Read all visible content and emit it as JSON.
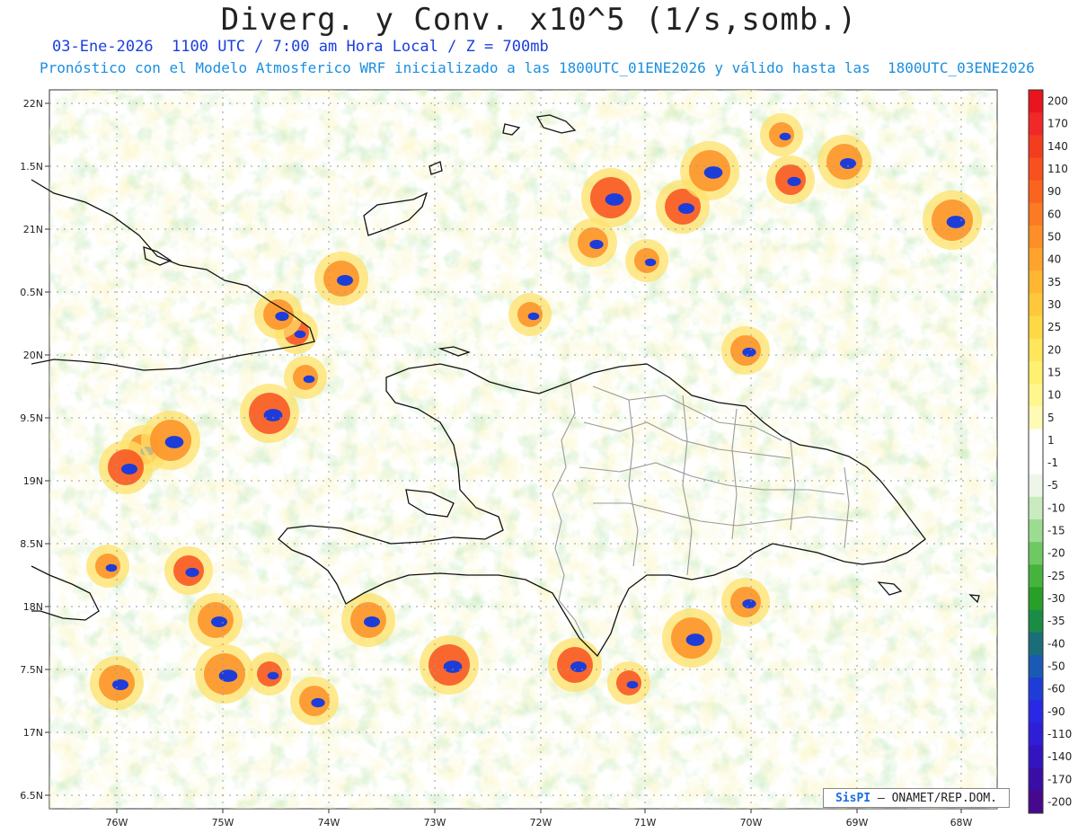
{
  "title": "Diverg. y Conv. x10^5 (1/s,somb.)",
  "subtitle_line1": "03-Ene-2026  1100 UTC / 7:00 am Hora Local / Z = 700mb",
  "subtitle_line2": "Pronóstico con el Modelo Atmosferico WRF inicializado a las 1800UTC_01ENE2026 y válido hasta las  1800UTC_03ENE2026",
  "credit": {
    "logo": "SisPI",
    "text": " – ONAMET/REP.DOM."
  },
  "lat_labels": [
    "22N",
    "1.5N",
    "21N",
    "0.5N",
    "20N",
    "9.5N",
    "19N",
    "8.5N",
    "18N",
    "7.5N",
    "17N",
    "6.5N"
  ],
  "lon_labels": [
    "76W",
    "75W",
    "74W",
    "73W",
    "72W",
    "71W",
    "70W",
    "69W",
    "68W"
  ],
  "colorbar": {
    "labels": [
      "200",
      "170",
      "140",
      "110",
      "90",
      "60",
      "50",
      "40",
      "35",
      "30",
      "25",
      "20",
      "15",
      "10",
      "5",
      "1",
      "-1",
      "-5",
      "-10",
      "-15",
      "-20",
      "-25",
      "-30",
      "-35",
      "-40",
      "-50",
      "-60",
      "-90",
      "-110",
      "-140",
      "-170",
      "-200"
    ],
    "colors": [
      "#e8141e",
      "#f02828",
      "#f43c1e",
      "#f8501e",
      "#fa641e",
      "#fc7a22",
      "#fd8f26",
      "#fea42c",
      "#ffb632",
      "#ffc83a",
      "#ffd846",
      "#ffe65a",
      "#fff070",
      "#fff68e",
      "#fffab4",
      "#ffffff",
      "#ffffff",
      "#eef6ea",
      "#c8ecc0",
      "#9cdc90",
      "#70c864",
      "#46b43c",
      "#28a028",
      "#1a8c46",
      "#1a6e78",
      "#1a5ab4",
      "#1e3cd8",
      "#2828e6",
      "#2e1ed8",
      "#3414c0",
      "#3a0ea4",
      "#46088c"
    ]
  },
  "colors": {
    "coast": "#111111",
    "provinces": "#9a9a9a",
    "grid": "#9a9a9a"
  }
}
